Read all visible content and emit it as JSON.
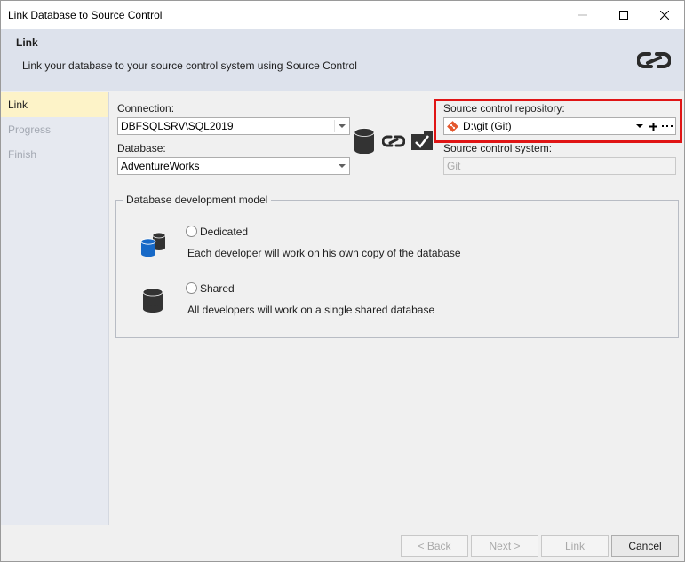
{
  "window": {
    "title": "Link Database to Source Control"
  },
  "header": {
    "title": "Link",
    "description": "Link your database to your source control system using Source Control",
    "icon": "link-icon"
  },
  "nav": {
    "items": [
      {
        "label": "Link",
        "state": "active"
      },
      {
        "label": "Progress",
        "state": "disabled"
      },
      {
        "label": "Finish",
        "state": "disabled"
      }
    ]
  },
  "connection": {
    "label": "Connection:",
    "value": "DBFSQLSRV\\SQL2019"
  },
  "database": {
    "label": "Database:",
    "value": "AdventureWorks"
  },
  "link_graphic": {
    "icons": [
      "database-icon",
      "link-icon",
      "source-control-icon"
    ]
  },
  "repository": {
    "label": "Source control repository:",
    "value": "D:\\git (Git)",
    "icon": "git-icon",
    "add_icon": "plus-icon",
    "more_icon": "ellipsis-icon"
  },
  "scs": {
    "label": "Source control system:",
    "value": "Git"
  },
  "dev_model": {
    "legend": "Database development model",
    "options": [
      {
        "label": "Dedicated",
        "description": "Each developer will work on his own copy of the database",
        "icon": "multiple-databases-icon",
        "selected": false
      },
      {
        "label": "Shared",
        "description": "All developers will work on a single shared database",
        "icon": "database-icon",
        "selected": false
      }
    ]
  },
  "footer": {
    "back": "< Back",
    "next": "Next >",
    "link": "Link",
    "cancel": "Cancel"
  },
  "colors": {
    "highlight": "#e01515",
    "git": "#e4572e",
    "active_nav": "#fdf3c8",
    "header_bg": "#dde2ec"
  }
}
